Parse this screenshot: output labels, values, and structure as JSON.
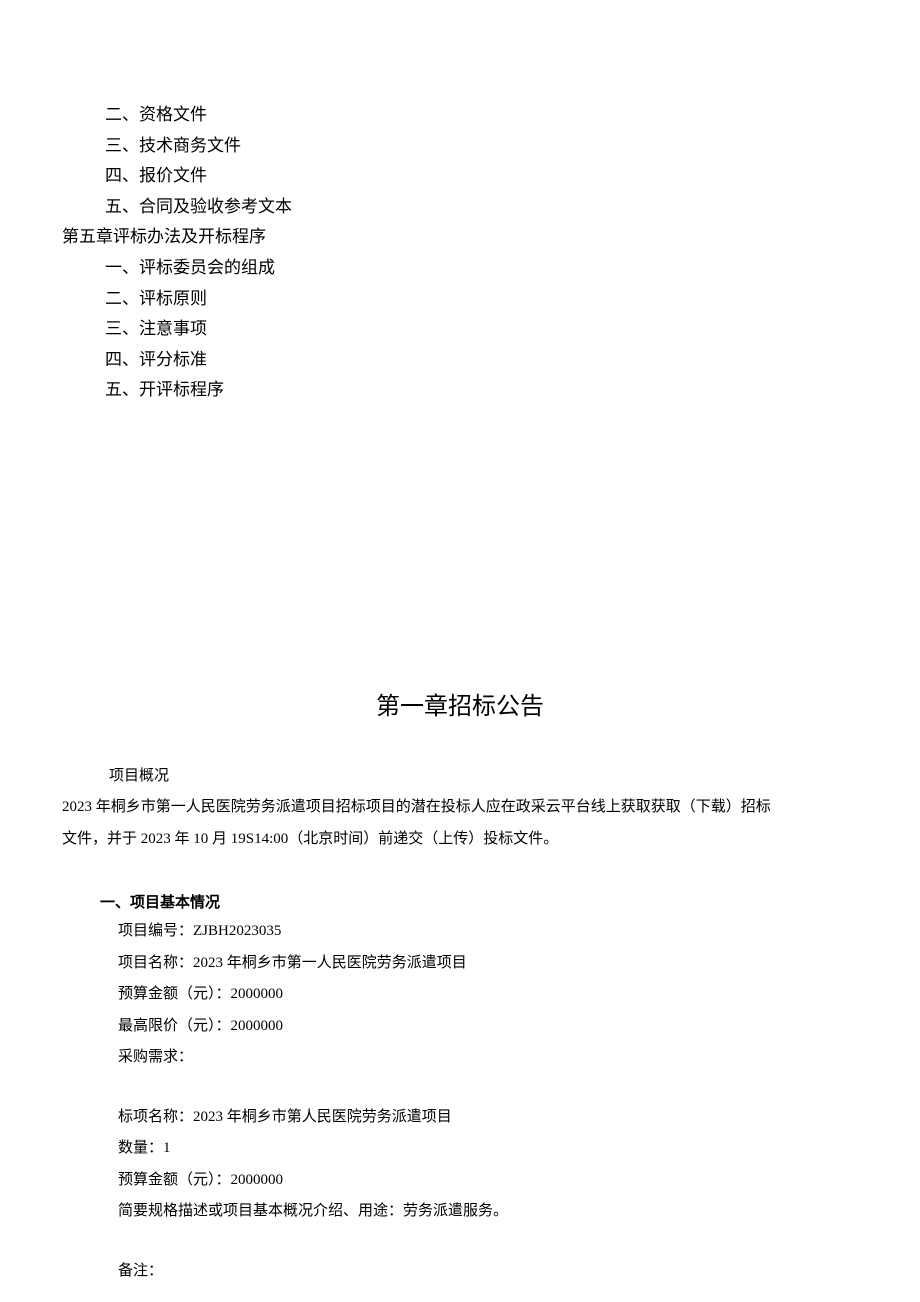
{
  "toc": {
    "items": [
      {
        "text": "二、资格文件",
        "type": "sub"
      },
      {
        "text": "三、技术商务文件",
        "type": "sub"
      },
      {
        "text": "四、报价文件",
        "type": "sub"
      },
      {
        "text": "五、合同及验收参考文本",
        "type": "sub"
      },
      {
        "text": "第五章评标办法及开标程序",
        "type": "chapter"
      },
      {
        "text": "一、评标委员会的组成",
        "type": "sub"
      },
      {
        "text": "二、评标原则",
        "type": "sub"
      },
      {
        "text": "三、注意事项",
        "type": "sub"
      },
      {
        "text": "四、评分标准",
        "type": "sub"
      },
      {
        "text": "五、开评标程序",
        "type": "sub"
      }
    ]
  },
  "chapter": {
    "title": "第一章招标公告"
  },
  "overview": {
    "label": "项目概况",
    "line1": "2023 年桐乡市第一人民医院劳务派遣项目招标项目的潜在投标人应在政采云平台线上获取获取（下载）招标",
    "line2": "文件，并于 2023 年 10 月 19S14:00（北京时间）前递交（上传）投标文件。"
  },
  "section1": {
    "heading": "一、项目基本情况",
    "project_number": "项目编号：ZJBH2023035",
    "project_name": "项目名称：2023 年桐乡市第一人民医院劳务派遣项目",
    "budget": "预算金额（元）：2000000",
    "max_price": "最高限价（元）：2000000",
    "requirements_label": "采购需求：",
    "bid_name": "标项名称：2023 年桐乡市第人民医院劳务派遣项目",
    "quantity": "数量：1",
    "budget_amount": "预算金额（元）：2000000",
    "description": "简要规格描述或项目基本概况介绍、用途：劳务派遣服务。",
    "remark": "备注："
  }
}
